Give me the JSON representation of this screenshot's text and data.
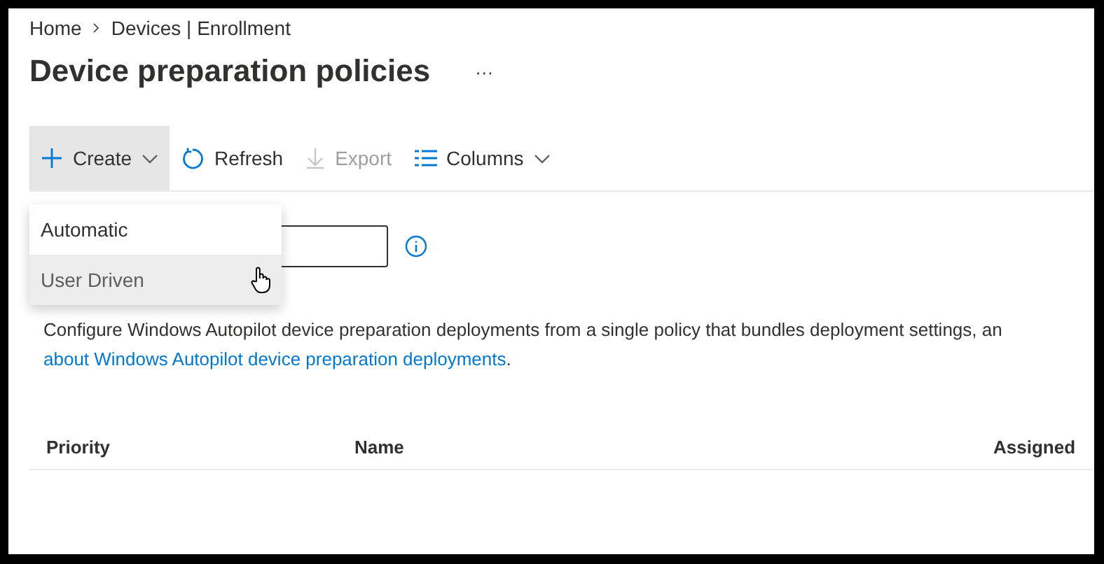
{
  "breadcrumb": [
    {
      "label": "Home"
    },
    {
      "label": "Devices | Enrollment"
    }
  ],
  "title": "Device preparation policies",
  "more_menu": "···",
  "toolbar": [
    {
      "kind": "create",
      "label": "Create",
      "disabled": false,
      "expanded": true
    },
    {
      "kind": "refresh",
      "label": "Refresh",
      "disabled": false,
      "expanded": false
    },
    {
      "kind": "export",
      "label": "Export",
      "disabled": true,
      "expanded": false
    },
    {
      "kind": "columns",
      "label": "Columns",
      "disabled": false,
      "expanded": false
    }
  ],
  "create_menu": [
    {
      "label": "Automatic",
      "selected": false
    },
    {
      "label": "User Driven",
      "selected": true
    }
  ],
  "description": {
    "text": "Configure Windows Autopilot device preparation deployments from a single policy that bundles deployment settings, an",
    "link": "about Windows Autopilot device preparation deployments",
    "end": "."
  },
  "table": {
    "columns": [
      "Priority",
      "Name",
      "Assigned"
    ]
  }
}
